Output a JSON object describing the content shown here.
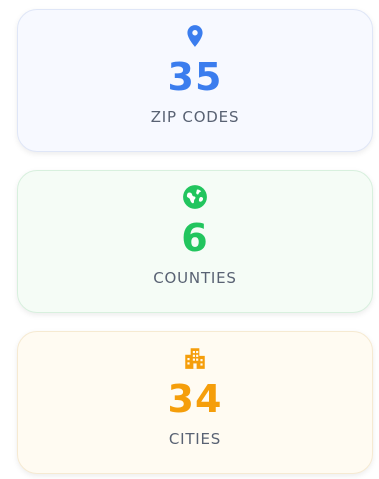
{
  "stats": [
    {
      "icon": "map-pin-icon",
      "value": "35",
      "label": "ZIP CODES",
      "color": "#3b7dee"
    },
    {
      "icon": "globe-icon",
      "value": "6",
      "label": "COUNTIES",
      "color": "#22c55e"
    },
    {
      "icon": "city-buildings-icon",
      "value": "34",
      "label": "CITIES",
      "color": "#f59e0b"
    }
  ]
}
